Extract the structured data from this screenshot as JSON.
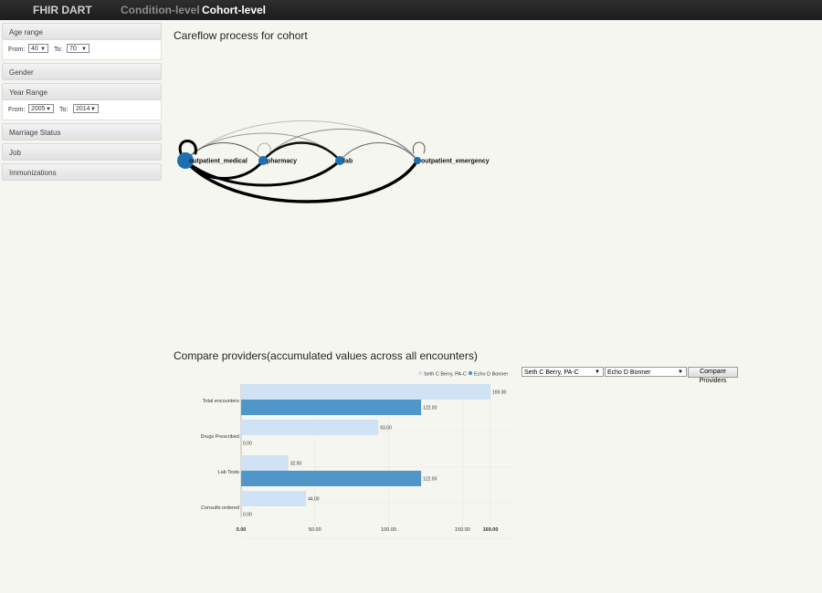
{
  "nav": {
    "brand": "FHIR DART",
    "items": [
      "Condition-level",
      "Cohort-level"
    ]
  },
  "sidebar": {
    "age_range": {
      "label": "Age range",
      "from_label": "From:",
      "from_value": "40",
      "to_label": "To:",
      "to_value": "70"
    },
    "gender": {
      "label": "Gender"
    },
    "year_range": {
      "label": "Year Range",
      "from_label": "From:",
      "from_value": "2005",
      "to_label": "To:",
      "to_value": "2014"
    },
    "marriage": {
      "label": "Marriage Status"
    },
    "job": {
      "label": "Job"
    },
    "immunizations": {
      "label": "Immunizations"
    }
  },
  "careflow": {
    "title": "Careflow process for cohort",
    "nodes": [
      "outpatient_medical",
      "pharmacy",
      "lab",
      "outpatient_emergency"
    ]
  },
  "compare": {
    "title": "Compare providers(accumulated values across all encounters)",
    "provider_1": "Seth C Berry, PA-C",
    "provider_2": "Echo D Bonner",
    "button": "Compare Providers"
  },
  "colors": {
    "series_1": "#cfe3f4",
    "series_2": "#5096c8",
    "node": "#1f6fb0"
  },
  "chart_data": {
    "type": "bar",
    "orientation": "horizontal",
    "categories": [
      "Total encounters",
      "Drugs Prescribed",
      "Lab Tests",
      "Consults ordered"
    ],
    "series": [
      {
        "name": "Seth C Berry, PA-C",
        "values": [
          169,
          93,
          32,
          44
        ]
      },
      {
        "name": "Echo D Bonner",
        "values": [
          122,
          0,
          122,
          0
        ]
      }
    ],
    "value_labels": [
      [
        "169.00",
        "93.00",
        "32.00",
        "44.00"
      ],
      [
        "122.00",
        "0.00",
        "122.00",
        "0.00"
      ]
    ],
    "xticks": [
      "0.00",
      "50.00",
      "100.00",
      "150.00",
      "169.00"
    ],
    "xlim": [
      0,
      169
    ],
    "legend_position": "top-right",
    "grid": true
  }
}
